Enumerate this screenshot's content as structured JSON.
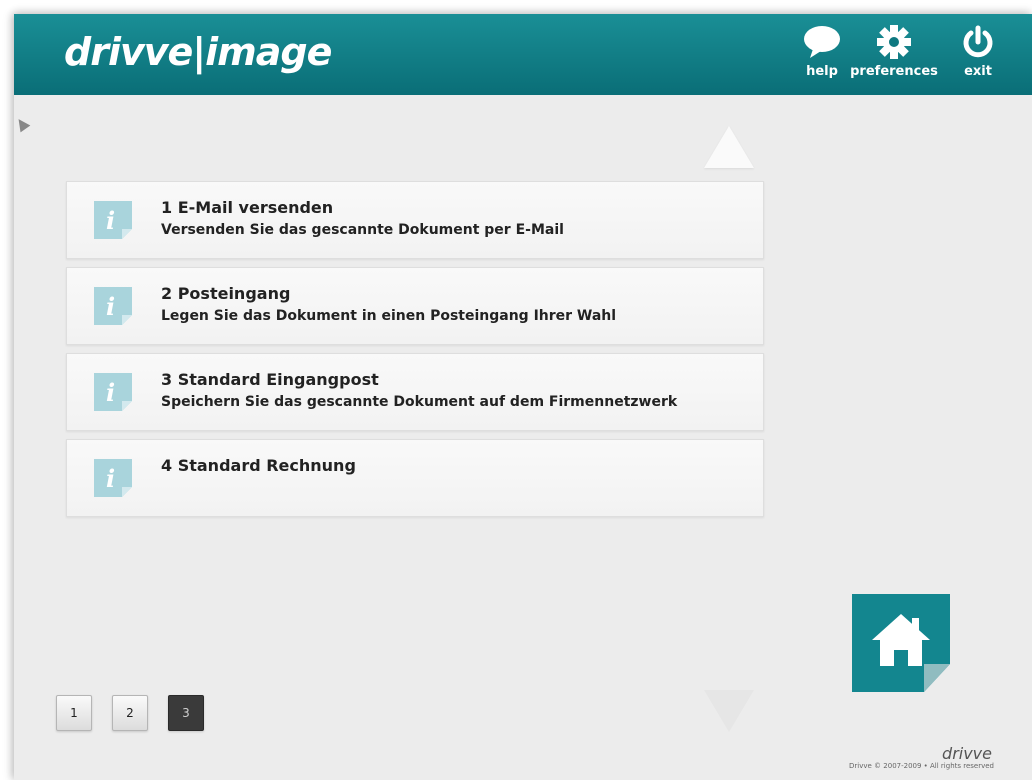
{
  "header": {
    "logo": "drivve|image",
    "buttons": [
      {
        "label": "help",
        "icon": "speech-bubble-icon"
      },
      {
        "label": "preferences",
        "icon": "gear-icon"
      },
      {
        "label": "exit",
        "icon": "power-icon"
      }
    ]
  },
  "items": [
    {
      "title": "1 E-Mail versenden",
      "description": "Versenden Sie das gescannte Dokument per E-Mail",
      "icon": "info-icon"
    },
    {
      "title": "2 Posteingang",
      "description": "Legen Sie das Dokument in einen Posteingang Ihrer Wahl",
      "icon": "info-icon"
    },
    {
      "title": "3 Standard Eingangpost",
      "description": "Speichern Sie das gescannte Dokument auf dem Firmennetzwerk",
      "icon": "info-icon"
    },
    {
      "title": "4 Standard Rechnung",
      "description": "",
      "icon": "info-icon"
    }
  ],
  "pagination": {
    "pages": [
      "1",
      "2",
      "3"
    ],
    "current": "3"
  },
  "home": {
    "icon": "home-icon"
  },
  "footer": {
    "logo": "drivve",
    "copyright": "Drivve © 2007-2009 • All rights reserved"
  },
  "colors": {
    "header": "#0d7880",
    "accent": "#1a8f96",
    "background": "#ececec",
    "active_page": "#3a3a3a"
  }
}
